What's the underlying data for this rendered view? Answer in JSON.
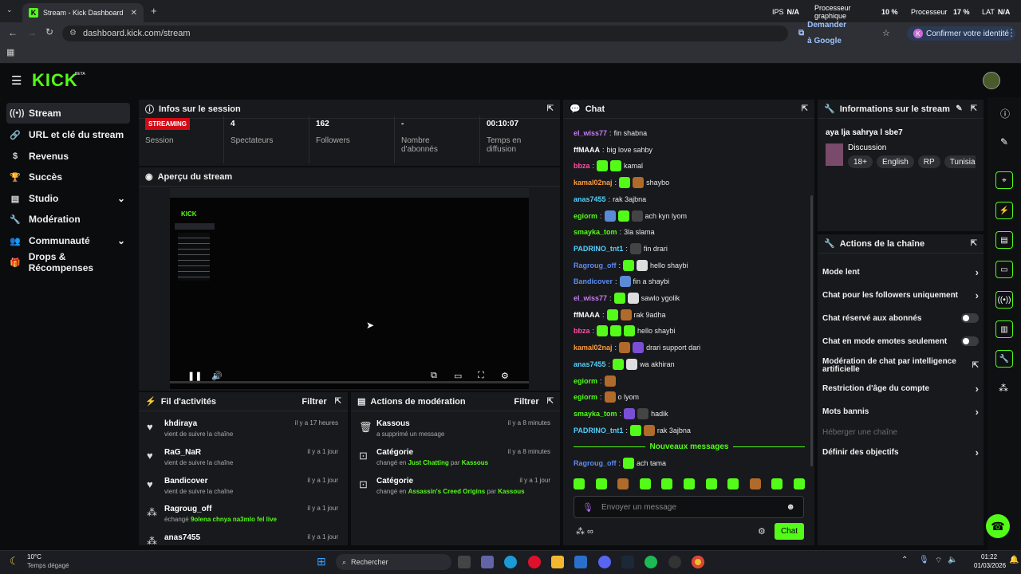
{
  "browser": {
    "tab_title": "Stream - Kick Dashboard",
    "url": "dashboard.kick.com/stream",
    "ask_google": "Demander à Google",
    "confirm_identity": "Confirmer votre identité",
    "overlay": {
      "ips_label": "IPS",
      "ips_value": "N/A",
      "gpu_label": "Processeur graphique",
      "gpu_value": "10 %",
      "cpu_label": "Processeur",
      "cpu_value": "17 %",
      "lat_label": "LAT",
      "lat_value": "N/A"
    }
  },
  "header": {
    "logo": "KICK",
    "beta": "BETA"
  },
  "sidebar": {
    "items": [
      {
        "label": "Stream",
        "icon": "broadcast-icon"
      },
      {
        "label": "URL et clé du stream",
        "icon": "link-icon"
      },
      {
        "label": "Revenus",
        "icon": "dollar-icon"
      },
      {
        "label": "Succès",
        "icon": "trophy-icon"
      },
      {
        "label": "Studio",
        "icon": "film-icon"
      },
      {
        "label": "Modération",
        "icon": "wrench-icon"
      },
      {
        "label": "Communauté",
        "icon": "users-icon"
      },
      {
        "label": "Drops & Récompenses",
        "icon": "gift-icon"
      }
    ]
  },
  "session": {
    "title": "Infos sur le session",
    "badge": "STREAMING",
    "session_label": "Session",
    "viewers": "4",
    "viewers_label": "Spectateurs",
    "followers": "162",
    "followers_label": "Followers",
    "subs": "-",
    "subs_label": "Nombre d'abonnés",
    "time": "00:10:07",
    "time_label": "Temps en diffusion"
  },
  "preview": {
    "title": "Aperçu du stream"
  },
  "activity": {
    "title": "Fil d'activités",
    "filter": "Filtrer",
    "rows": [
      {
        "name": "khdiraya",
        "sub": "vient de suivre la chaîne",
        "time": "il y a 17 heures",
        "icon": "heart-icon"
      },
      {
        "name": "RaG_NaR",
        "sub": "vient de suivre la chaîne",
        "time": "il y a 1 jour",
        "icon": "heart-icon"
      },
      {
        "name": "Bandicover",
        "sub": "vient de suivre la chaîne",
        "time": "il y a 1 jour",
        "icon": "heart-icon"
      },
      {
        "name": "Ragroug_off",
        "sub": "échangé",
        "sub_highlight": "9olena chnya na3mlo fel live",
        "time": "il y a 1 jour",
        "icon": "gift-icon"
      },
      {
        "name": "anas7455",
        "sub": "",
        "time": "il y a 1 jour",
        "icon": "gift-icon"
      }
    ]
  },
  "modactions": {
    "title": "Actions de modération",
    "filter": "Filtrer",
    "rows": [
      {
        "name": "Kassous",
        "sub": "a supprimé un message",
        "time": "il y a 8 minutes",
        "icon": "trash-icon"
      },
      {
        "name": "Catégorie",
        "sub_pre": "changé en",
        "cat": "Just Chatting",
        "by": "par",
        "user": "Kassous",
        "time": "il y a 8 minutes",
        "icon": "category-icon"
      },
      {
        "name": "Catégorie",
        "sub_pre": "changé en",
        "cat": "Assassin's Creed Origins",
        "by": "par",
        "user": "Kassous",
        "time": "il y a 1 jour",
        "icon": "category-icon"
      }
    ]
  },
  "chat": {
    "title": "Chat",
    "messages": [
      {
        "user": "el_wiss77",
        "color": "#c97cf5",
        "text": "fin shabna",
        "emotes": []
      },
      {
        "user": "ffMAAA",
        "color": "#ffffff",
        "text": "big love sahby",
        "emotes": []
      },
      {
        "user": "bbza",
        "color": "#ff4fa8",
        "text": "kamal",
        "emotes": [
          "g",
          "g"
        ]
      },
      {
        "user": "kamal02naj",
        "color": "#ff9b3d",
        "text": "shaybo",
        "emotes": [
          "g",
          "o"
        ]
      },
      {
        "user": "anas7455",
        "color": "#53d0ff",
        "text": "rak 3ajbna",
        "emotes": []
      },
      {
        "user": "egiorm",
        "color": "#53fc18",
        "text": "ach kyn lyom",
        "emotes": [
          "b",
          "g",
          "d"
        ]
      },
      {
        "user": "smayka_tom",
        "color": "#53fc18",
        "text": "3la slama",
        "emotes": []
      },
      {
        "user": "PADRINO_tnt1",
        "color": "#53d0ff",
        "text": "fin drari",
        "emotes": [
          "d"
        ]
      },
      {
        "user": "Ragroug_off",
        "color": "#5b8bf5",
        "text": "hello shaybi",
        "emotes": [
          "g",
          "w"
        ]
      },
      {
        "user": "Bandicover",
        "color": "#5b8bf5",
        "text": "fin a shaybi",
        "emotes": [
          "b"
        ]
      },
      {
        "user": "el_wiss77",
        "color": "#c97cf5",
        "text": "sawlo ygolik",
        "emotes": [
          "g",
          "w"
        ]
      },
      {
        "user": "ffMAAA",
        "color": "#ffffff",
        "text": "rak 9adha",
        "emotes": [
          "g",
          "o"
        ]
      },
      {
        "user": "bbza",
        "color": "#ff4fa8",
        "text": "hello shaybi",
        "emotes": [
          "g",
          "g",
          "g"
        ]
      },
      {
        "user": "kamal02naj",
        "color": "#ff9b3d",
        "text": "drari support dari",
        "emotes": [
          "o",
          "p"
        ]
      },
      {
        "user": "anas7455",
        "color": "#53d0ff",
        "text": "wa akhiran",
        "emotes": [
          "g",
          "w"
        ]
      },
      {
        "user": "egiorm",
        "color": "#53fc18",
        "text": "",
        "emotes": [
          "o"
        ]
      },
      {
        "user": "egiorm",
        "color": "#53fc18",
        "text": "o lyom",
        "emotes": [
          "o"
        ]
      },
      {
        "user": "smayka_tom",
        "color": "#53fc18",
        "text": "hadik",
        "emotes": [
          "p",
          "d"
        ]
      },
      {
        "user": "PADRINO_tnt1",
        "color": "#53d0ff",
        "text": "rak 3ajbna",
        "emotes": [
          "g",
          "o"
        ]
      }
    ],
    "new_messages": "Nouveaux messages",
    "new_message": {
      "user": "Ragroug_off",
      "color": "#5b8bf5",
      "text": "ach tama"
    },
    "input_placeholder": "Envoyer un message",
    "send": "Chat"
  },
  "streaminfo": {
    "title": "Informations sur le stream",
    "stream_title": "aya lja sahrya l sbe7",
    "category": "Discussion",
    "tags": [
      "18+",
      "English",
      "RP",
      "TunisianGa"
    ]
  },
  "channel_actions": {
    "title": "Actions de la chaîne",
    "items": [
      {
        "label": "Mode lent",
        "control": "chevron"
      },
      {
        "label": "Chat pour les followers uniquement",
        "control": "chevron"
      },
      {
        "label": "Chat réservé aux abonnés",
        "control": "toggle"
      },
      {
        "label": "Chat en mode emotes seulement",
        "control": "toggle"
      },
      {
        "label": "Modération de chat par intelligence artificielle",
        "control": "external"
      },
      {
        "label": "Restriction d'âge du compte",
        "control": "chevron"
      },
      {
        "label": "Mots bannis",
        "control": "chevron"
      },
      {
        "label": "Héberger une chaîne",
        "control": "disabled"
      },
      {
        "label": "Définir des objectifs",
        "control": "chevron"
      }
    ]
  },
  "taskbar": {
    "weather_temp": "10°C",
    "weather_desc": "Temps dégagé",
    "search": "Rechercher",
    "time": "01:22",
    "date": "01/03/2026"
  },
  "colors": {
    "accent": "#53fc18",
    "badge_red": "#d20a14"
  }
}
